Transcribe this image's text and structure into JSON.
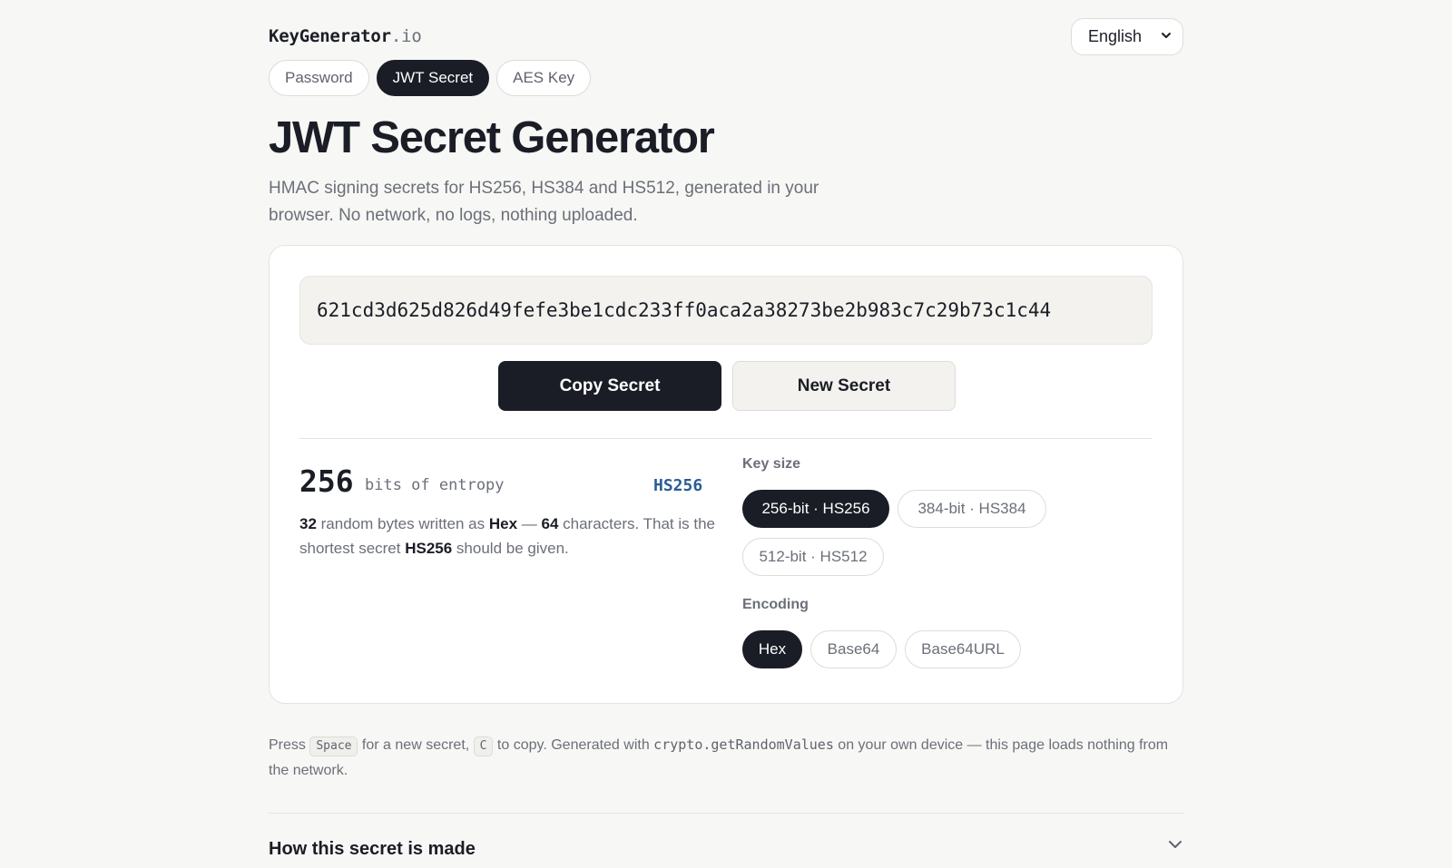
{
  "brand": {
    "name": "KeyGenerator",
    "tld": ".io"
  },
  "language": {
    "selected": "English"
  },
  "tabs": [
    {
      "label": "Password",
      "active": false
    },
    {
      "label": "JWT Secret",
      "active": true
    },
    {
      "label": "AES Key",
      "active": false
    }
  ],
  "page": {
    "title": "JWT Secret Generator",
    "subtitle": "HMAC signing secrets for HS256, HS384 and HS512, generated in your browser. No network, no logs, nothing uploaded."
  },
  "generator": {
    "secret": "621cd3d625d826d49fefe3be1cdc233ff0aca2a38273be2b983c7c29b73c1c44",
    "copy_label": "Copy Secret",
    "new_label": "New Secret"
  },
  "entropy": {
    "bits": "256",
    "label": "bits of entropy",
    "algorithm": "HS256",
    "desc": {
      "bytes": "32",
      "t1": " random bytes written as ",
      "encoding": "Hex",
      "t2": " — ",
      "chars": "64",
      "t3": " characters. That is the shortest secret ",
      "algorithm": "HS256",
      "t4": " should be given."
    }
  },
  "key_size": {
    "label": "Key size",
    "options": [
      {
        "label": "256-bit · HS256",
        "active": true
      },
      {
        "label": "384-bit · HS384",
        "active": false
      },
      {
        "label": "512-bit · HS512",
        "active": false
      }
    ]
  },
  "encoding": {
    "label": "Encoding",
    "options": [
      {
        "label": "Hex",
        "active": true
      },
      {
        "label": "Base64",
        "active": false
      },
      {
        "label": "Base64URL",
        "active": false
      }
    ]
  },
  "footnote": {
    "press": "Press ",
    "key_space": "Space",
    "mid1": " for a new secret, ",
    "key_c": "C",
    "mid2": " to copy. Generated with ",
    "api": "crypto.getRandomValues",
    "end": " on your own device — this page loads nothing from the network."
  },
  "faq": {
    "title": "How this secret is made"
  },
  "colors": {
    "ink": "#1b1d26",
    "accent_blue": "#2a5c98",
    "background": "#f7f7f5"
  },
  "icons": {
    "language_chevron": "chevron-down-icon",
    "faq_chevron": "chevron-down-icon"
  }
}
